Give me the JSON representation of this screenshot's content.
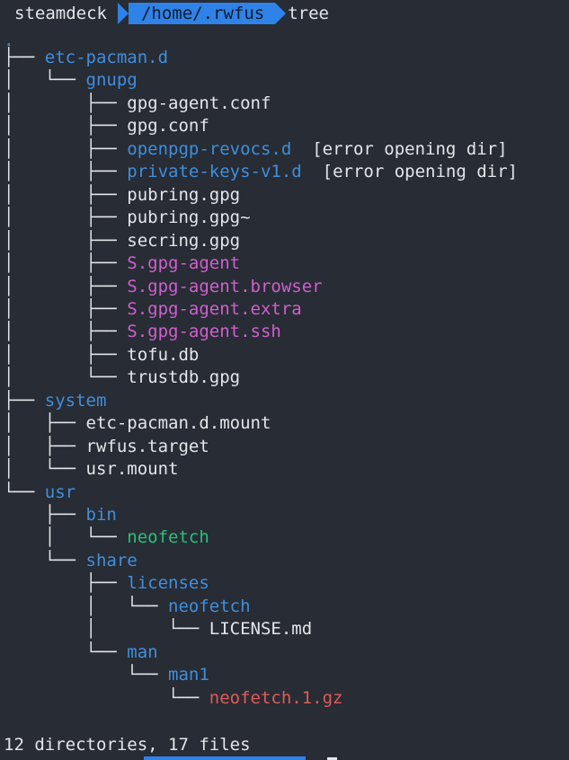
{
  "prompt": {
    "host": "steamdeck",
    "path": "/home/.rwfus",
    "command": "tree"
  },
  "root": ".",
  "entries": [
    {
      "prefix": "├── ",
      "name": "etc-pacman.d",
      "kind": "dir"
    },
    {
      "prefix": "│   └── ",
      "name": "gnupg",
      "kind": "dir"
    },
    {
      "prefix": "│       ├── ",
      "name": "gpg-agent.conf",
      "kind": "file"
    },
    {
      "prefix": "│       ├── ",
      "name": "gpg.conf",
      "kind": "file"
    },
    {
      "prefix": "│       ├── ",
      "name": "openpgp-revocs.d",
      "kind": "dir",
      "note": "  [error opening dir]"
    },
    {
      "prefix": "│       ├── ",
      "name": "private-keys-v1.d",
      "kind": "dir",
      "note": "  [error opening dir]"
    },
    {
      "prefix": "│       ├── ",
      "name": "pubring.gpg",
      "kind": "file"
    },
    {
      "prefix": "│       ├── ",
      "name": "pubring.gpg~",
      "kind": "file"
    },
    {
      "prefix": "│       ├── ",
      "name": "secring.gpg",
      "kind": "file"
    },
    {
      "prefix": "│       ├── ",
      "name": "S.gpg-agent",
      "kind": "sock"
    },
    {
      "prefix": "│       ├── ",
      "name": "S.gpg-agent.browser",
      "kind": "sock"
    },
    {
      "prefix": "│       ├── ",
      "name": "S.gpg-agent.extra",
      "kind": "sock"
    },
    {
      "prefix": "│       ├── ",
      "name": "S.gpg-agent.ssh",
      "kind": "sock"
    },
    {
      "prefix": "│       ├── ",
      "name": "tofu.db",
      "kind": "file"
    },
    {
      "prefix": "│       └── ",
      "name": "trustdb.gpg",
      "kind": "file"
    },
    {
      "prefix": "├── ",
      "name": "system",
      "kind": "dir"
    },
    {
      "prefix": "│   ├── ",
      "name": "etc-pacman.d.mount",
      "kind": "file"
    },
    {
      "prefix": "│   ├── ",
      "name": "rwfus.target",
      "kind": "file"
    },
    {
      "prefix": "│   └── ",
      "name": "usr.mount",
      "kind": "file"
    },
    {
      "prefix": "└── ",
      "name": "usr",
      "kind": "dir"
    },
    {
      "prefix": "    ├── ",
      "name": "bin",
      "kind": "dir"
    },
    {
      "prefix": "    │   └── ",
      "name": "neofetch",
      "kind": "exe"
    },
    {
      "prefix": "    └── ",
      "name": "share",
      "kind": "dir"
    },
    {
      "prefix": "        ├── ",
      "name": "licenses",
      "kind": "dir"
    },
    {
      "prefix": "        │   └── ",
      "name": "neofetch",
      "kind": "dir"
    },
    {
      "prefix": "        │       └── ",
      "name": "LICENSE.md",
      "kind": "file"
    },
    {
      "prefix": "        └── ",
      "name": "man",
      "kind": "dir"
    },
    {
      "prefix": "            └── ",
      "name": "man1",
      "kind": "dir"
    },
    {
      "prefix": "                └── ",
      "name": "neofetch.1.gz",
      "kind": "arch"
    }
  ],
  "summary": "12 directories, 17 files",
  "colors": {
    "background": "#282c34",
    "directory": "#3f8fde",
    "executable": "#27c07a",
    "socket": "#d05fd0",
    "archive": "#e05a5a",
    "prompt_path_bg": "#2f82e8"
  }
}
